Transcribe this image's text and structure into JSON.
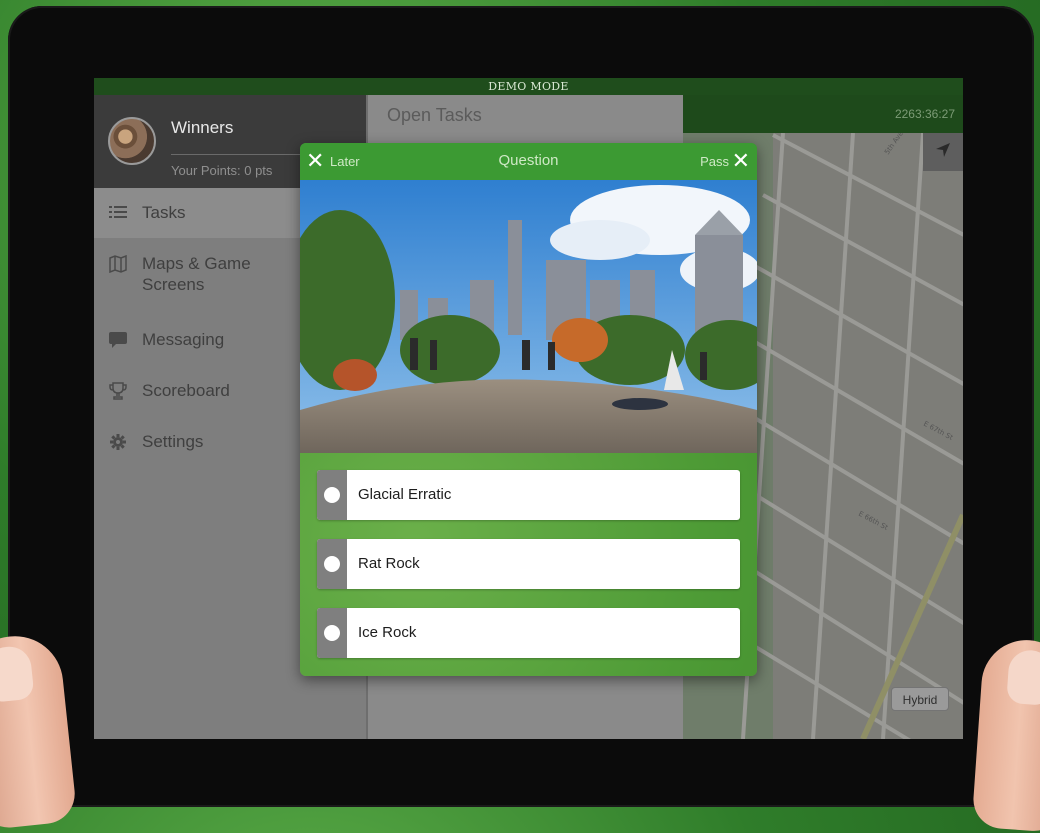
{
  "banner": {
    "text": "DEMO MODE"
  },
  "sidebar": {
    "team_name": "Winners",
    "points": "Your Points: 0 pts",
    "items": [
      {
        "label": "Tasks",
        "icon": "list-icon"
      },
      {
        "label": "Maps & Game Screens",
        "icon": "map-icon"
      },
      {
        "label": "Messaging",
        "icon": "chat-bubble-icon"
      },
      {
        "label": "Scoreboard",
        "icon": "trophy-icon"
      },
      {
        "label": "Settings",
        "icon": "gear-icon"
      }
    ]
  },
  "tasks_panel": {
    "title": "Open Tasks"
  },
  "map": {
    "timer": "2263:36:27",
    "hybrid_label": "Hybrid",
    "street_labels": [
      "5th Ave",
      "E 67th St",
      "E 66th St"
    ]
  },
  "dialog": {
    "later_label": "Later",
    "title": "Question",
    "pass_label": "Pass",
    "answers": [
      {
        "label": "Glacial Erratic"
      },
      {
        "label": "Rat Rock"
      },
      {
        "label": "Ice Rock"
      }
    ]
  },
  "colors": {
    "accent_green": "#3c9a33",
    "dark_green_bar": "#1f4d1c",
    "dim_overlay": "#8a8a8a"
  }
}
